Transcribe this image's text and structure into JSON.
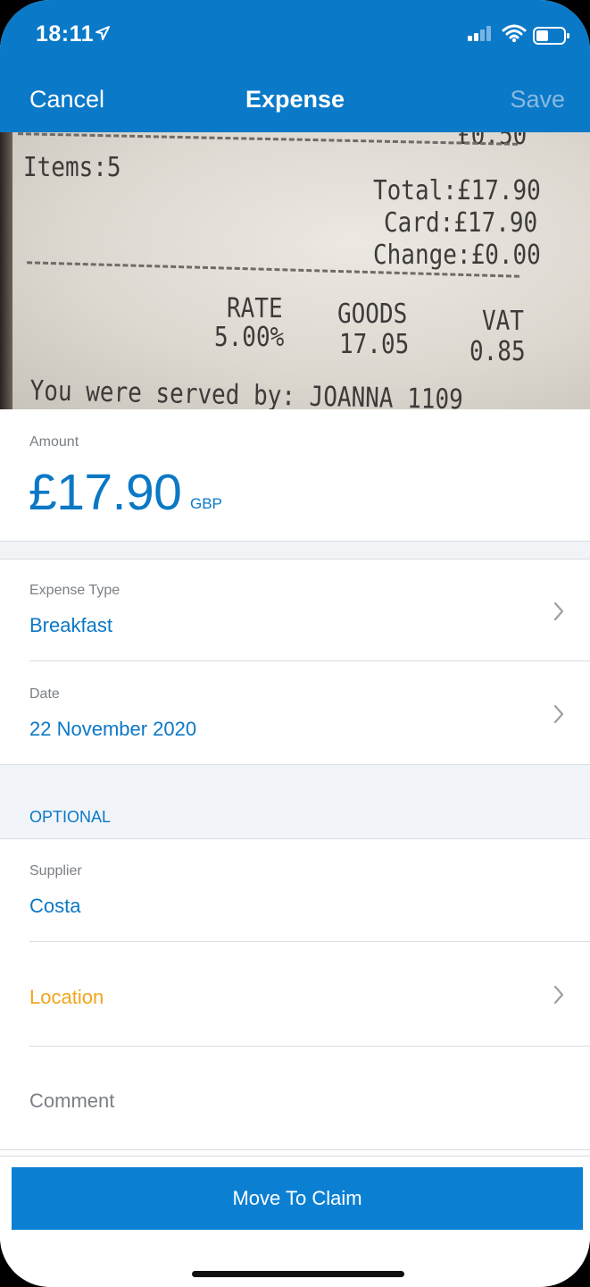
{
  "status_bar": {
    "time": "18:11"
  },
  "nav": {
    "cancel": "Cancel",
    "title": "Expense",
    "save": "Save"
  },
  "receipt": {
    "top_cut": "£0.50",
    "items": "Items:5",
    "total": "Total:£17.90",
    "card": "Card:£17.90",
    "change": "Change:£0.00",
    "rate_h": "RATE",
    "goods_h": "GOODS",
    "vat_h": "VAT",
    "rate_v": "5.00%",
    "goods_v": "17.05",
    "vat_v": "0.85",
    "served_by": "You were served by: JOANNA 1109"
  },
  "amount": {
    "label": "Amount",
    "value": "£17.90",
    "currency": "GBP"
  },
  "expense_type": {
    "label": "Expense Type",
    "value": "Breakfast"
  },
  "date": {
    "label": "Date",
    "value": "22 November 2020"
  },
  "optional": {
    "header": "OPTIONAL"
  },
  "supplier": {
    "label": "Supplier",
    "value": "Costa"
  },
  "location": {
    "label": "Location"
  },
  "comment": {
    "placeholder": "Comment"
  },
  "actions": {
    "move_to_claim": "Move To Claim"
  },
  "colors": {
    "header_bg": "#0a79c8",
    "accent": "#0b78c6",
    "location": "#f1a51b",
    "button_bg": "#0b80d3"
  },
  "icons": [
    "location-arrow-icon",
    "signal-icon",
    "wifi-icon",
    "battery-icon",
    "chevron-right-icon"
  ]
}
